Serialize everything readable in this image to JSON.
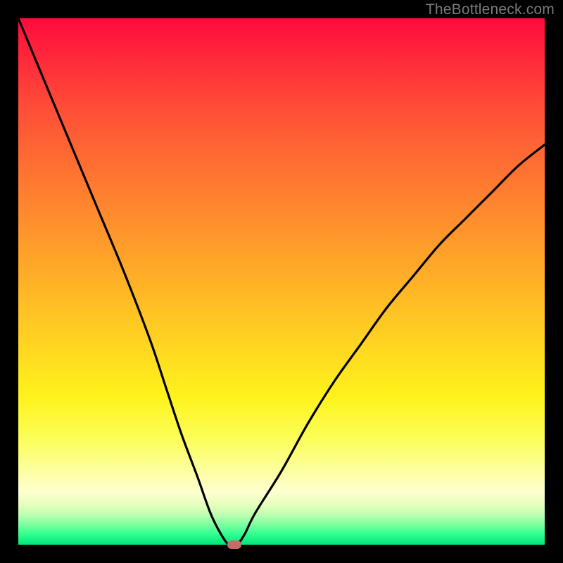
{
  "watermark": "TheBottleneck.com",
  "chart_data": {
    "type": "line",
    "title": "",
    "xlabel": "",
    "ylabel": "",
    "xlim": [
      0,
      100
    ],
    "ylim": [
      0,
      100
    ],
    "grid": false,
    "legend": false,
    "series": [
      {
        "name": "bottleneck-curve",
        "x": [
          0,
          5,
          10,
          15,
          20,
          25,
          28,
          31,
          34,
          36.5,
          38.5,
          40,
          41.5,
          43,
          45,
          50,
          55,
          60,
          65,
          70,
          75,
          80,
          85,
          90,
          95,
          100
        ],
        "values": [
          100,
          88,
          76,
          64,
          52,
          39,
          30,
          21,
          13,
          6,
          2,
          0,
          0,
          2,
          6,
          14,
          23,
          31,
          38,
          45,
          51,
          57,
          62,
          67,
          72,
          76
        ]
      }
    ],
    "marker": {
      "x": 41,
      "y": 0,
      "color": "#c96a6a"
    },
    "background_gradient": {
      "top": "#ff0b3c",
      "mid": "#fff31c",
      "bottom": "#00e678"
    }
  }
}
